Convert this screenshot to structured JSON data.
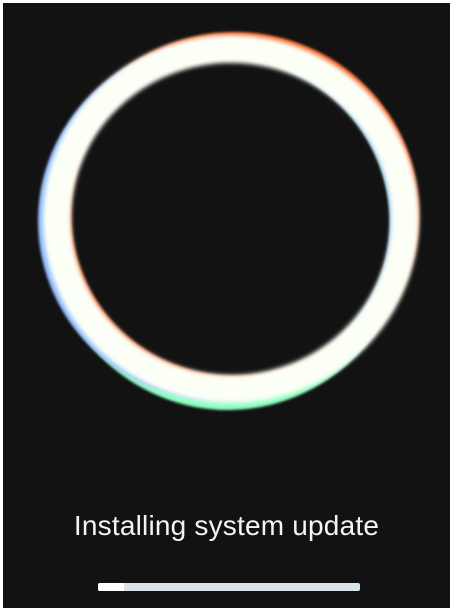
{
  "screen": {
    "message": "Installing system update",
    "progress": 0.1,
    "colors": {
      "background": "#121212",
      "ring_main": "#fbfff6",
      "ring_orange": "#ff6a2f",
      "ring_green": "#8dffc0",
      "ring_blue": "#8ebcff",
      "progress_track": "#d8e3ea",
      "progress_fill": "#ffffff",
      "text": "#f4f4f4"
    }
  }
}
